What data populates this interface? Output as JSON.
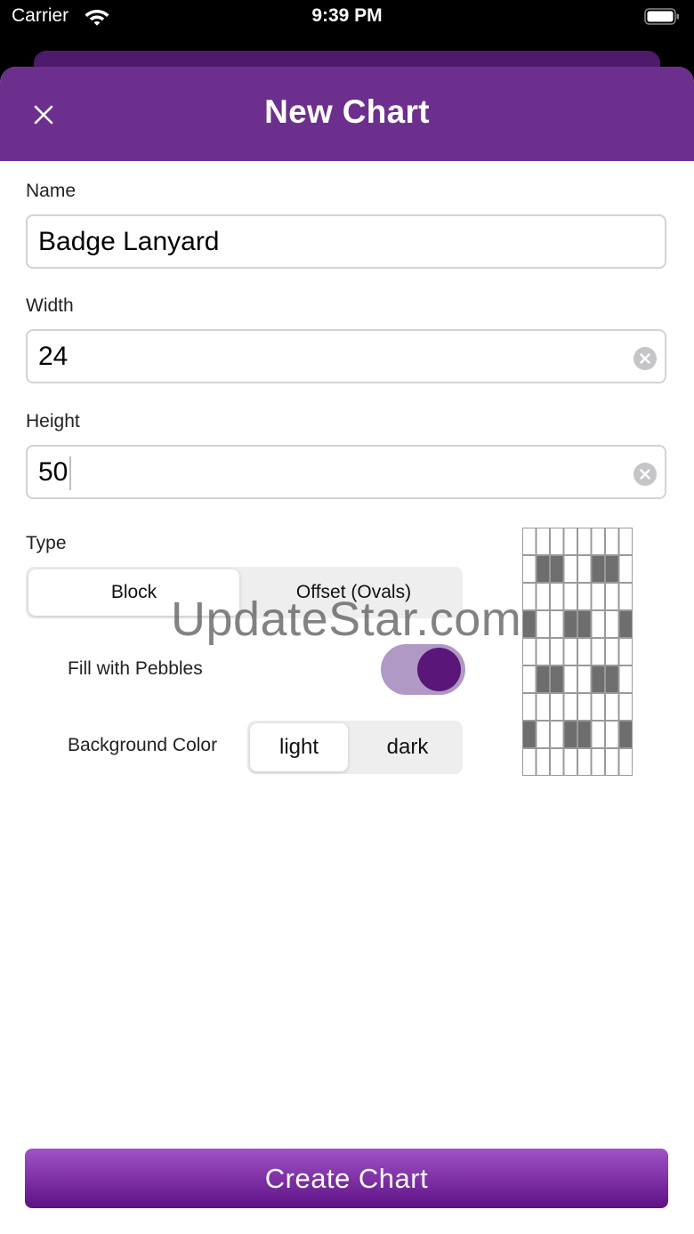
{
  "status_bar": {
    "carrier": "Carrier",
    "time": "9:39 PM"
  },
  "nav": {
    "title": "New Chart"
  },
  "form": {
    "name": {
      "label": "Name",
      "value": "Badge Lanyard"
    },
    "width": {
      "label": "Width",
      "value": "24"
    },
    "height": {
      "label": "Height",
      "value": "50"
    },
    "type": {
      "label": "Type",
      "options": [
        "Block",
        "Offset (Ovals)"
      ],
      "selected": "Block"
    },
    "fill_pebbles": {
      "label": "Fill with Pebbles",
      "on": true
    },
    "background_color": {
      "label": "Background Color",
      "options": [
        "light",
        "dark"
      ],
      "selected": "light"
    }
  },
  "preview_pattern": [
    [
      0,
      0,
      0,
      0,
      0,
      0,
      0,
      0
    ],
    [
      0,
      1,
      1,
      0,
      0,
      1,
      1,
      0
    ],
    [
      0,
      0,
      0,
      0,
      0,
      0,
      0,
      0
    ],
    [
      1,
      0,
      0,
      1,
      1,
      0,
      0,
      1
    ],
    [
      0,
      0,
      0,
      0,
      0,
      0,
      0,
      0
    ],
    [
      0,
      1,
      1,
      0,
      0,
      1,
      1,
      0
    ],
    [
      0,
      0,
      0,
      0,
      0,
      0,
      0,
      0
    ],
    [
      1,
      0,
      0,
      1,
      1,
      0,
      0,
      1
    ],
    [
      0,
      0,
      0,
      0,
      0,
      0,
      0,
      0
    ]
  ],
  "watermark": "UpdateStar.com",
  "create_button": {
    "label": "Create Chart"
  },
  "colors": {
    "nav_bar": "#6d2f8d",
    "toggle_knob": "#5a1679",
    "toggle_track": "#b099c4",
    "cell_filled": "#6e6e6e",
    "button_top": "#a052c8",
    "button_bottom": "#5e1183"
  }
}
